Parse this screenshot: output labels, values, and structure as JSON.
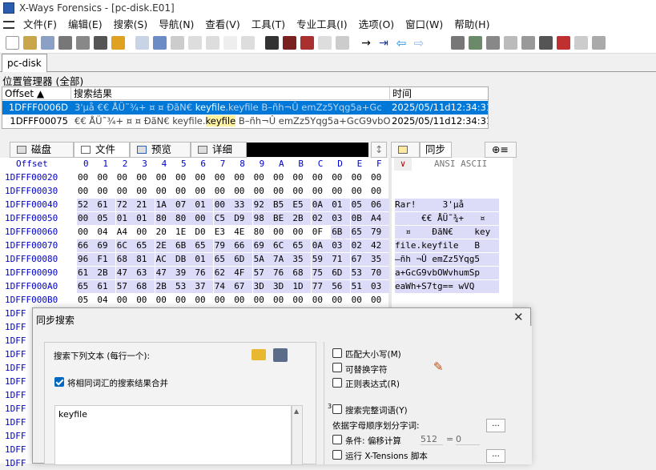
{
  "window": {
    "title": "X-Ways Forensics - [pc-disk.E01]"
  },
  "menu": {
    "items": [
      "文件(F)",
      "编辑(E)",
      "搜索(S)",
      "导航(N)",
      "查看(V)",
      "工具(T)",
      "专业工具(I)",
      "选项(O)",
      "窗口(W)",
      "帮助(H)"
    ]
  },
  "tabs": {
    "active": "pc-disk"
  },
  "panel": {
    "title": "位置管理器 (全部)"
  },
  "results": {
    "headers": {
      "offset": "Offset",
      "search_hits": "搜索结果",
      "time": "时间"
    },
    "rows": [
      {
        "offset": "1DFFF0006D",
        "before": "3'µå      €€ ÅÜ˜¾+   ¤  ¤   ĐãN€ ",
        "hit": "keyfile",
        "after": ".keyfile   B–ñh¬Û emZz5Yqg5a+Gc",
        "time": "2025/05/11d12:34:31"
      },
      {
        "offset": "1DFFF00075",
        "before": "€€ ÅÜ˜¾+   ¤  ¤   ĐãN€  keyfile.",
        "hit": "keyfile",
        "after": "  B–ñh¬Û emZz5Yqg5a+GcG9vbO",
        "time": "2025/05/11d12:34:31"
      }
    ]
  },
  "view_tabs": {
    "disk": "磁盘",
    "file": "文件",
    "preview": "预览",
    "details": "详细",
    "sync": "同步"
  },
  "hex": {
    "offset_label": "Offset",
    "columns": [
      "0",
      "1",
      "2",
      "3",
      "4",
      "5",
      "6",
      "7",
      "8",
      "9",
      "A",
      "B",
      "C",
      "D",
      "E",
      "F"
    ],
    "ansi_label": "ANSI ASCII",
    "rows": [
      {
        "offset": "1DFFF00020",
        "bytes": [
          "00",
          "00",
          "00",
          "00",
          "00",
          "00",
          "00",
          "00",
          "00",
          "00",
          "00",
          "00",
          "00",
          "00",
          "00",
          "00"
        ],
        "ansi": ""
      },
      {
        "offset": "1DFFF00030",
        "bytes": [
          "00",
          "00",
          "00",
          "00",
          "00",
          "00",
          "00",
          "00",
          "00",
          "00",
          "00",
          "00",
          "00",
          "00",
          "00",
          "00"
        ],
        "ansi": ""
      },
      {
        "offset": "1DFFF00040",
        "bytes": [
          "52",
          "61",
          "72",
          "21",
          "1A",
          "07",
          "01",
          "00",
          "33",
          "92",
          "B5",
          "E5",
          "0A",
          "01",
          "05",
          "06"
        ],
        "ansi": "Rar!     3'µå"
      },
      {
        "offset": "1DFFF00050",
        "bytes": [
          "00",
          "05",
          "01",
          "01",
          "80",
          "80",
          "00",
          "C5",
          "D9",
          "98",
          "BE",
          "2B",
          "02",
          "03",
          "0B",
          "A4"
        ],
        "ansi": "     €€ ÅÜ˜¾+   ¤"
      },
      {
        "offset": "1DFFF00060",
        "bytes": [
          "00",
          "04",
          "A4",
          "00",
          "20",
          "1E",
          "D0",
          "E3",
          "4E",
          "80",
          "00",
          "00",
          "0F",
          "6B",
          "65",
          "79"
        ],
        "ansi": "  ¤    ĐãN€    key"
      },
      {
        "offset": "1DFFF00070",
        "bytes": [
          "66",
          "69",
          "6C",
          "65",
          "2E",
          "6B",
          "65",
          "79",
          "66",
          "69",
          "6C",
          "65",
          "0A",
          "03",
          "02",
          "42"
        ],
        "ansi": "file.keyfile   B"
      },
      {
        "offset": "1DFFF00080",
        "bytes": [
          "96",
          "F1",
          "68",
          "81",
          "AC",
          "DB",
          "01",
          "65",
          "6D",
          "5A",
          "7A",
          "35",
          "59",
          "71",
          "67",
          "35"
        ],
        "ansi": "–ñh ¬Û emZz5Yqg5"
      },
      {
        "offset": "1DFFF00090",
        "bytes": [
          "61",
          "2B",
          "47",
          "63",
          "47",
          "39",
          "76",
          "62",
          "4F",
          "57",
          "76",
          "68",
          "75",
          "6D",
          "53",
          "70"
        ],
        "ansi": "a+GcG9vbOWvhumSp"
      },
      {
        "offset": "1DFFF000A0",
        "bytes": [
          "65",
          "61",
          "57",
          "68",
          "2B",
          "53",
          "37",
          "74",
          "67",
          "3D",
          "3D",
          "1D",
          "77",
          "56",
          "51",
          "03"
        ],
        "ansi": "eaWh+S7tg== wVQ"
      },
      {
        "offset": "1DFFF000B0",
        "bytes": [
          "05",
          "04",
          "00",
          "00",
          "00",
          "00",
          "00",
          "00",
          "00",
          "00",
          "00",
          "00",
          "00",
          "00",
          "00",
          "00"
        ],
        "ansi": ""
      },
      {
        "offset": "1DFF",
        "bytes": [],
        "ansi": ""
      },
      {
        "offset": "1DFF",
        "bytes": [],
        "ansi": ""
      },
      {
        "offset": "1DFF",
        "bytes": [],
        "ansi": ""
      },
      {
        "offset": "1DFF",
        "bytes": [],
        "ansi": ""
      },
      {
        "offset": "1DFF",
        "bytes": [],
        "ansi": ""
      },
      {
        "offset": "1DFF",
        "bytes": [],
        "ansi": ""
      },
      {
        "offset": "1DFF",
        "bytes": [],
        "ansi": ""
      },
      {
        "offset": "1DFF",
        "bytes": [],
        "ansi": ""
      },
      {
        "offset": "1DFF",
        "bytes": [],
        "ansi": ""
      },
      {
        "offset": "1DFF",
        "bytes": [],
        "ansi": ""
      },
      {
        "offset": "1DFF",
        "bytes": [],
        "ansi": ""
      },
      {
        "offset": "1DFF",
        "bytes": [],
        "ansi": ""
      }
    ]
  },
  "dialog": {
    "title": "同步搜索",
    "search_label": "搜索下列文本 (每行一个):",
    "merge_label": "将相同词汇的搜索结果合并",
    "search_text": "keyfile",
    "match_case": "匹配大小写(M)",
    "replace_chars": "可替换字符",
    "regex": "正则表达式(R)",
    "whole_word": "搜索完整词语(Y)",
    "split_label": "依据字母顺序划分字词:",
    "condition": "条件: 偏移计算",
    "offset_value": "512",
    "equals": "=",
    "result_value": "0",
    "x_tensions": "运行 X-Tensions 脚本",
    "ellipsis": "...",
    "side_mark": "3"
  },
  "colors": {
    "selection": "#0078d7",
    "hex_highlight": "#dcdcf8",
    "hit_highlight": "#fff3a0",
    "offset_blue": "#0000c8"
  },
  "icons": [
    "open-folder-icon",
    "save-disk-icon",
    "pencil-icon",
    "close-icon",
    "checkbox-icon"
  ]
}
